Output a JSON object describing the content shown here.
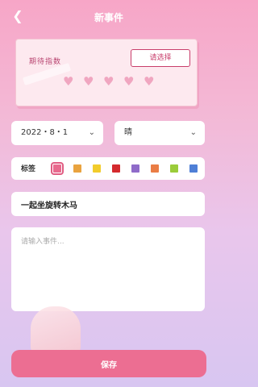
{
  "header": {
    "title": "新事件",
    "back_icon": "chevron-left-icon"
  },
  "rating": {
    "label": "期待指数",
    "select_label": "请选择",
    "hearts_total": 5
  },
  "date_select": {
    "value": "2022・8・1"
  },
  "weather_select": {
    "value": "晴"
  },
  "tags": {
    "label": "标签",
    "swatches": [
      {
        "color": "#e86a8e",
        "selected": true
      },
      {
        "color": "#e9a33f",
        "selected": false
      },
      {
        "color": "#f2cc2c",
        "selected": false
      },
      {
        "color": "#d42a2e",
        "selected": false
      },
      {
        "color": "#8f6bc9",
        "selected": false
      },
      {
        "color": "#ea7d45",
        "selected": false
      },
      {
        "color": "#9bcc3a",
        "selected": false
      },
      {
        "color": "#4f7fd6",
        "selected": false
      }
    ]
  },
  "event_title": {
    "value": "一起坐旋转木马"
  },
  "event_content": {
    "placeholder": "请输入事件..."
  },
  "save_button": {
    "label": "保存"
  },
  "colors": {
    "accent": "#ec6e92",
    "card_border": "#f4c5d3"
  }
}
